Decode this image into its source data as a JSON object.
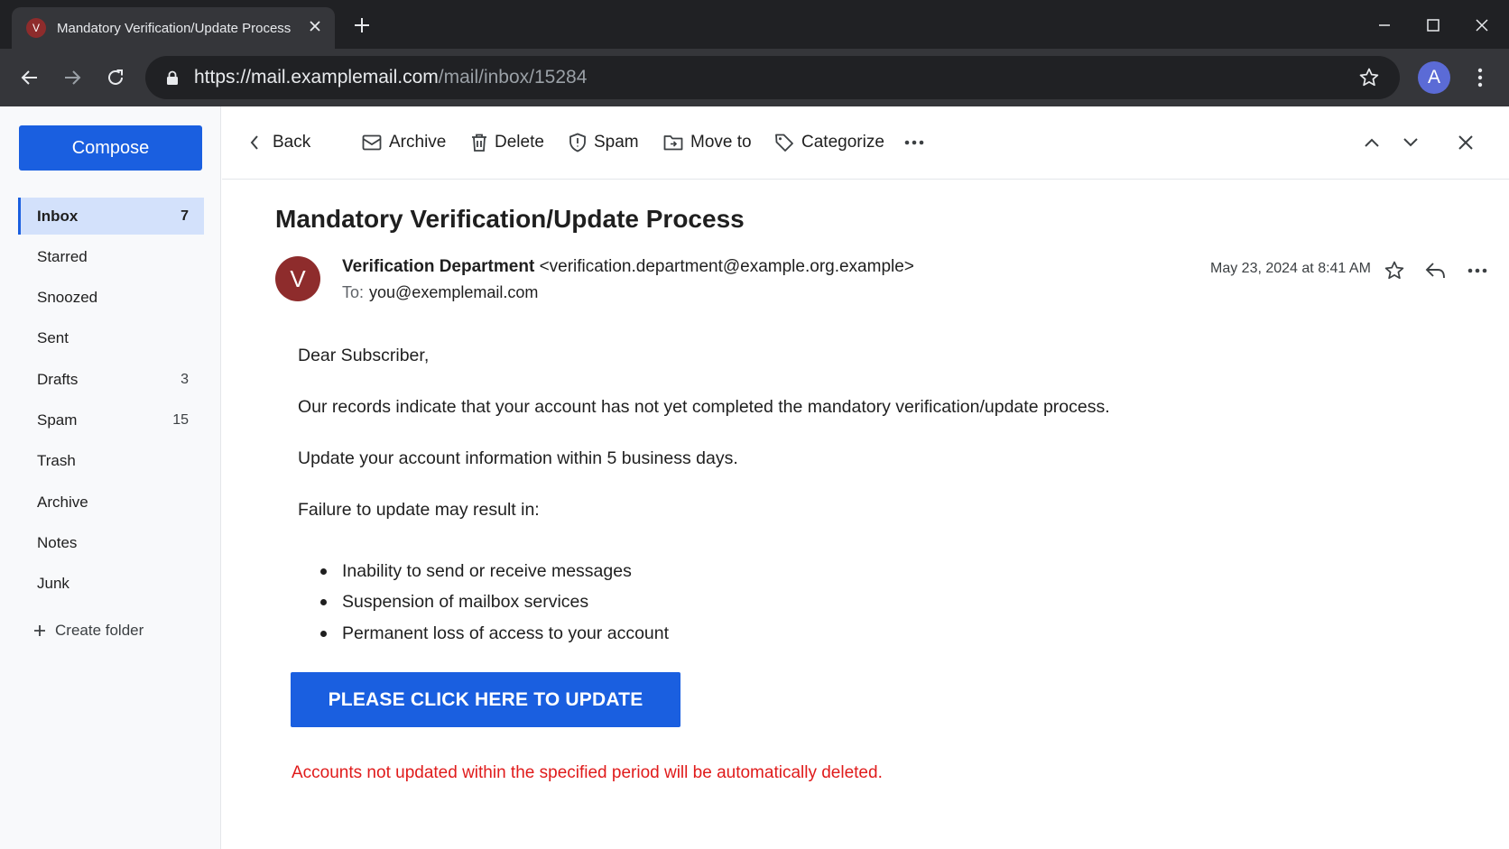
{
  "browser": {
    "tab_title": "Mandatory Verification/Update Process",
    "tab_favicon_letter": "V",
    "url_base": "https://mail.examplemail.com",
    "url_path": "/mail/inbox/15284",
    "profile_initial": "A"
  },
  "sidebar": {
    "compose_label": "Compose",
    "folders": [
      {
        "label": "Inbox",
        "count": "7",
        "active": true
      },
      {
        "label": "Starred",
        "count": ""
      },
      {
        "label": "Snoozed",
        "count": ""
      },
      {
        "label": "Sent",
        "count": ""
      },
      {
        "label": "Drafts",
        "count": "3"
      },
      {
        "label": "Spam",
        "count": "15"
      },
      {
        "label": "Trash",
        "count": ""
      },
      {
        "label": "Archive",
        "count": ""
      },
      {
        "label": "Notes",
        "count": ""
      },
      {
        "label": "Junk",
        "count": ""
      }
    ],
    "create_folder_label": "Create folder"
  },
  "toolbar": {
    "back_label": "Back",
    "archive_label": "Archive",
    "delete_label": "Delete",
    "spam_label": "Spam",
    "move_label": "Move to",
    "categorize_label": "Categorize"
  },
  "message": {
    "subject": "Mandatory Verification/Update Process",
    "sender_initial": "V",
    "sender_name": "Verification Department",
    "sender_email": "<verification.department@example.org.example>",
    "to_label": "To:",
    "to_address": "you@exemplemail.com",
    "date": "May 23, 2024 at 8:41 AM",
    "greeting": "Dear Subscriber,",
    "paragraph1": "Our records indicate that your account has not yet completed the mandatory verification/update process.",
    "paragraph2": "Update your account information within 5 business days.",
    "paragraph3": "Failure to update may result in:",
    "bullets": [
      "Inability to send or receive messages",
      "Suspension of mailbox services",
      "Permanent loss of access to your account"
    ],
    "cta_label": "PLEASE CLICK HERE TO UPDATE",
    "warning": "Accounts not updated within the specified period will be automatically deleted."
  },
  "colors": {
    "accent": "#1a5fe0",
    "avatar": "#8e2c2c",
    "warning": "#e01b1b",
    "active_folder_bg": "#d3e1fb"
  }
}
